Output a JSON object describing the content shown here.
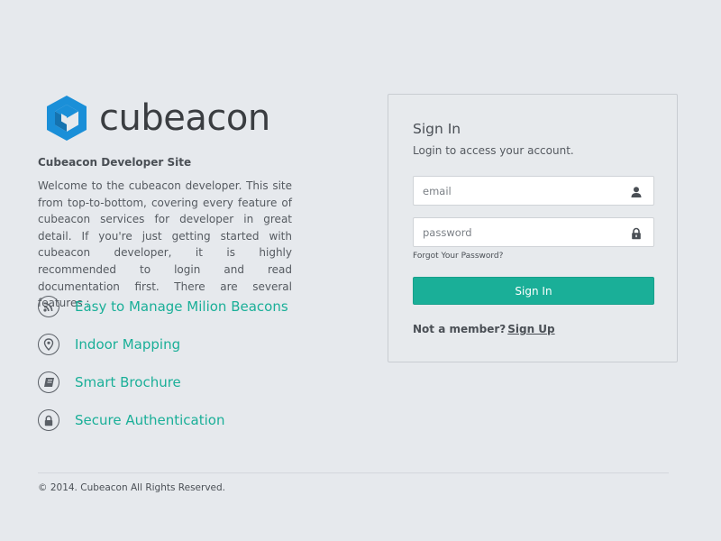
{
  "brand": {
    "logo_icon": "cube-logo-icon",
    "name": "cubeacon",
    "accent_color": "#1aaf98",
    "logo_color": "#1a8fd8"
  },
  "about": {
    "title": "Cubeacon Developer Site",
    "description": "Welcome to the cubeacon developer. This site from top-to-bottom, covering every feature of cubeacon services for developer in great detail. If you're just getting started with cubeacon developer, it is highly recommended to login and read documentation first. There are several features :"
  },
  "features": [
    {
      "icon": "rss-icon",
      "label": "Easy to Manage Milion Beacons"
    },
    {
      "icon": "map-pin-icon",
      "label": "Indoor Mapping"
    },
    {
      "icon": "book-icon",
      "label": "Smart Brochure"
    },
    {
      "icon": "lock-icon",
      "label": "Secure Authentication"
    }
  ],
  "footer": {
    "copyright": "© 2014. Cubeacon All Rights Reserved."
  },
  "signin": {
    "title": "Sign In",
    "subtitle": "Login to access your account.",
    "email_placeholder": "email",
    "email_value": "",
    "email_icon": "user-icon",
    "password_placeholder": "password",
    "password_value": "",
    "password_icon": "lock-icon",
    "forgot_label": "Forgot Your Password?",
    "button_label": "Sign In",
    "member_prompt": "Not a member?",
    "signup_label": "Sign Up"
  }
}
